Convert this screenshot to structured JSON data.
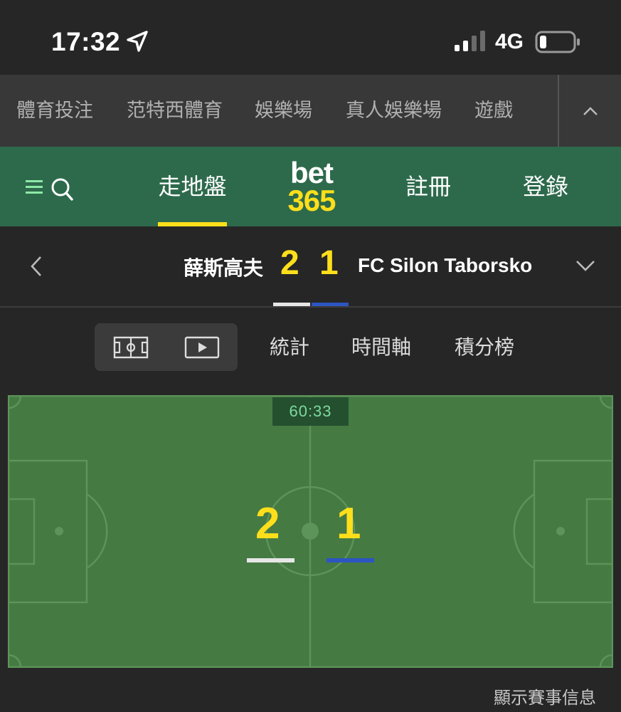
{
  "status_bar": {
    "time": "17:32",
    "network": "4G",
    "icons": [
      "location-arrow-icon",
      "signal-icon",
      "battery-icon"
    ]
  },
  "product_menu": {
    "items": [
      {
        "label": "體育投注"
      },
      {
        "label": "范特西體育"
      },
      {
        "label": "娛樂場"
      },
      {
        "label": "真人娛樂場"
      },
      {
        "label": "遊戲"
      }
    ],
    "collapse_icon": "chevron-up-icon"
  },
  "header": {
    "menu_icon": "hamburger-icon",
    "search_icon": "search-icon",
    "live": "走地盤",
    "logo_top": "bet",
    "logo_bottom": "365",
    "register": "註冊",
    "login": "登錄"
  },
  "match": {
    "home_team": "薛斯高夫",
    "home_score": "2",
    "away_score": "1",
    "away_team": "FC Silon Taborsko",
    "home_color": "#e6e6e6",
    "away_color": "#2d55c2"
  },
  "view_tabs": {
    "pitch_icon": "pitch-icon",
    "video_icon": "play-video-icon",
    "stats": "統計",
    "timeline": "時間軸",
    "standings": "積分榜"
  },
  "pitch": {
    "clock": "60:33",
    "home_score": "2",
    "away_score": "1"
  },
  "footer": {
    "show_info": "顯示賽事信息"
  },
  "colors": {
    "brand_green": "#2d6a4b",
    "accent_yellow": "#ffdf1b",
    "pitch_green": "#457a43",
    "background": "#262626"
  }
}
